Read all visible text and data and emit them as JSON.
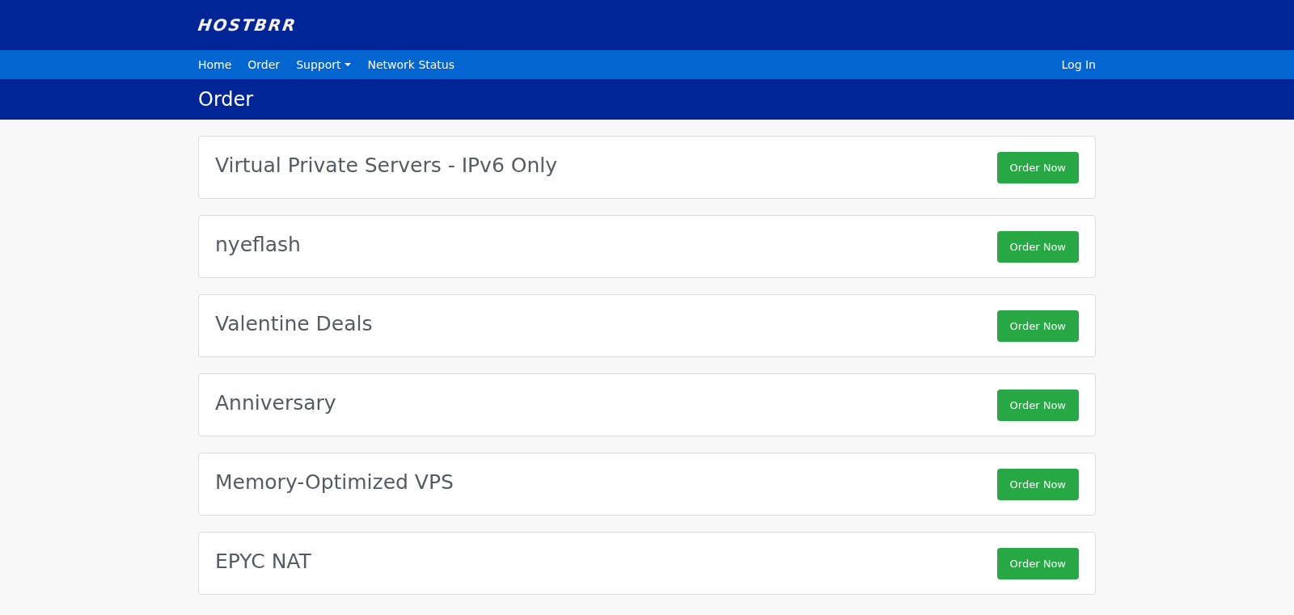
{
  "header": {
    "logo": "HOSTBRR"
  },
  "nav": {
    "items": [
      {
        "label": "Home",
        "kind": "link"
      },
      {
        "label": "Order",
        "kind": "link"
      },
      {
        "label": "Support",
        "kind": "dropdown"
      },
      {
        "label": "Network Status",
        "kind": "link"
      }
    ],
    "login": "Log In"
  },
  "page_title": "Order",
  "categories": [
    {
      "name": "Virtual Private Servers - IPv6 Only",
      "button": "Order Now"
    },
    {
      "name": "nyeflash",
      "button": "Order Now"
    },
    {
      "name": "Valentine Deals",
      "button": "Order Now"
    },
    {
      "name": "Anniversary",
      "button": "Order Now"
    },
    {
      "name": "Memory-Optimized VPS",
      "button": "Order Now"
    },
    {
      "name": "EPYC NAT",
      "button": "Order Now"
    }
  ]
}
